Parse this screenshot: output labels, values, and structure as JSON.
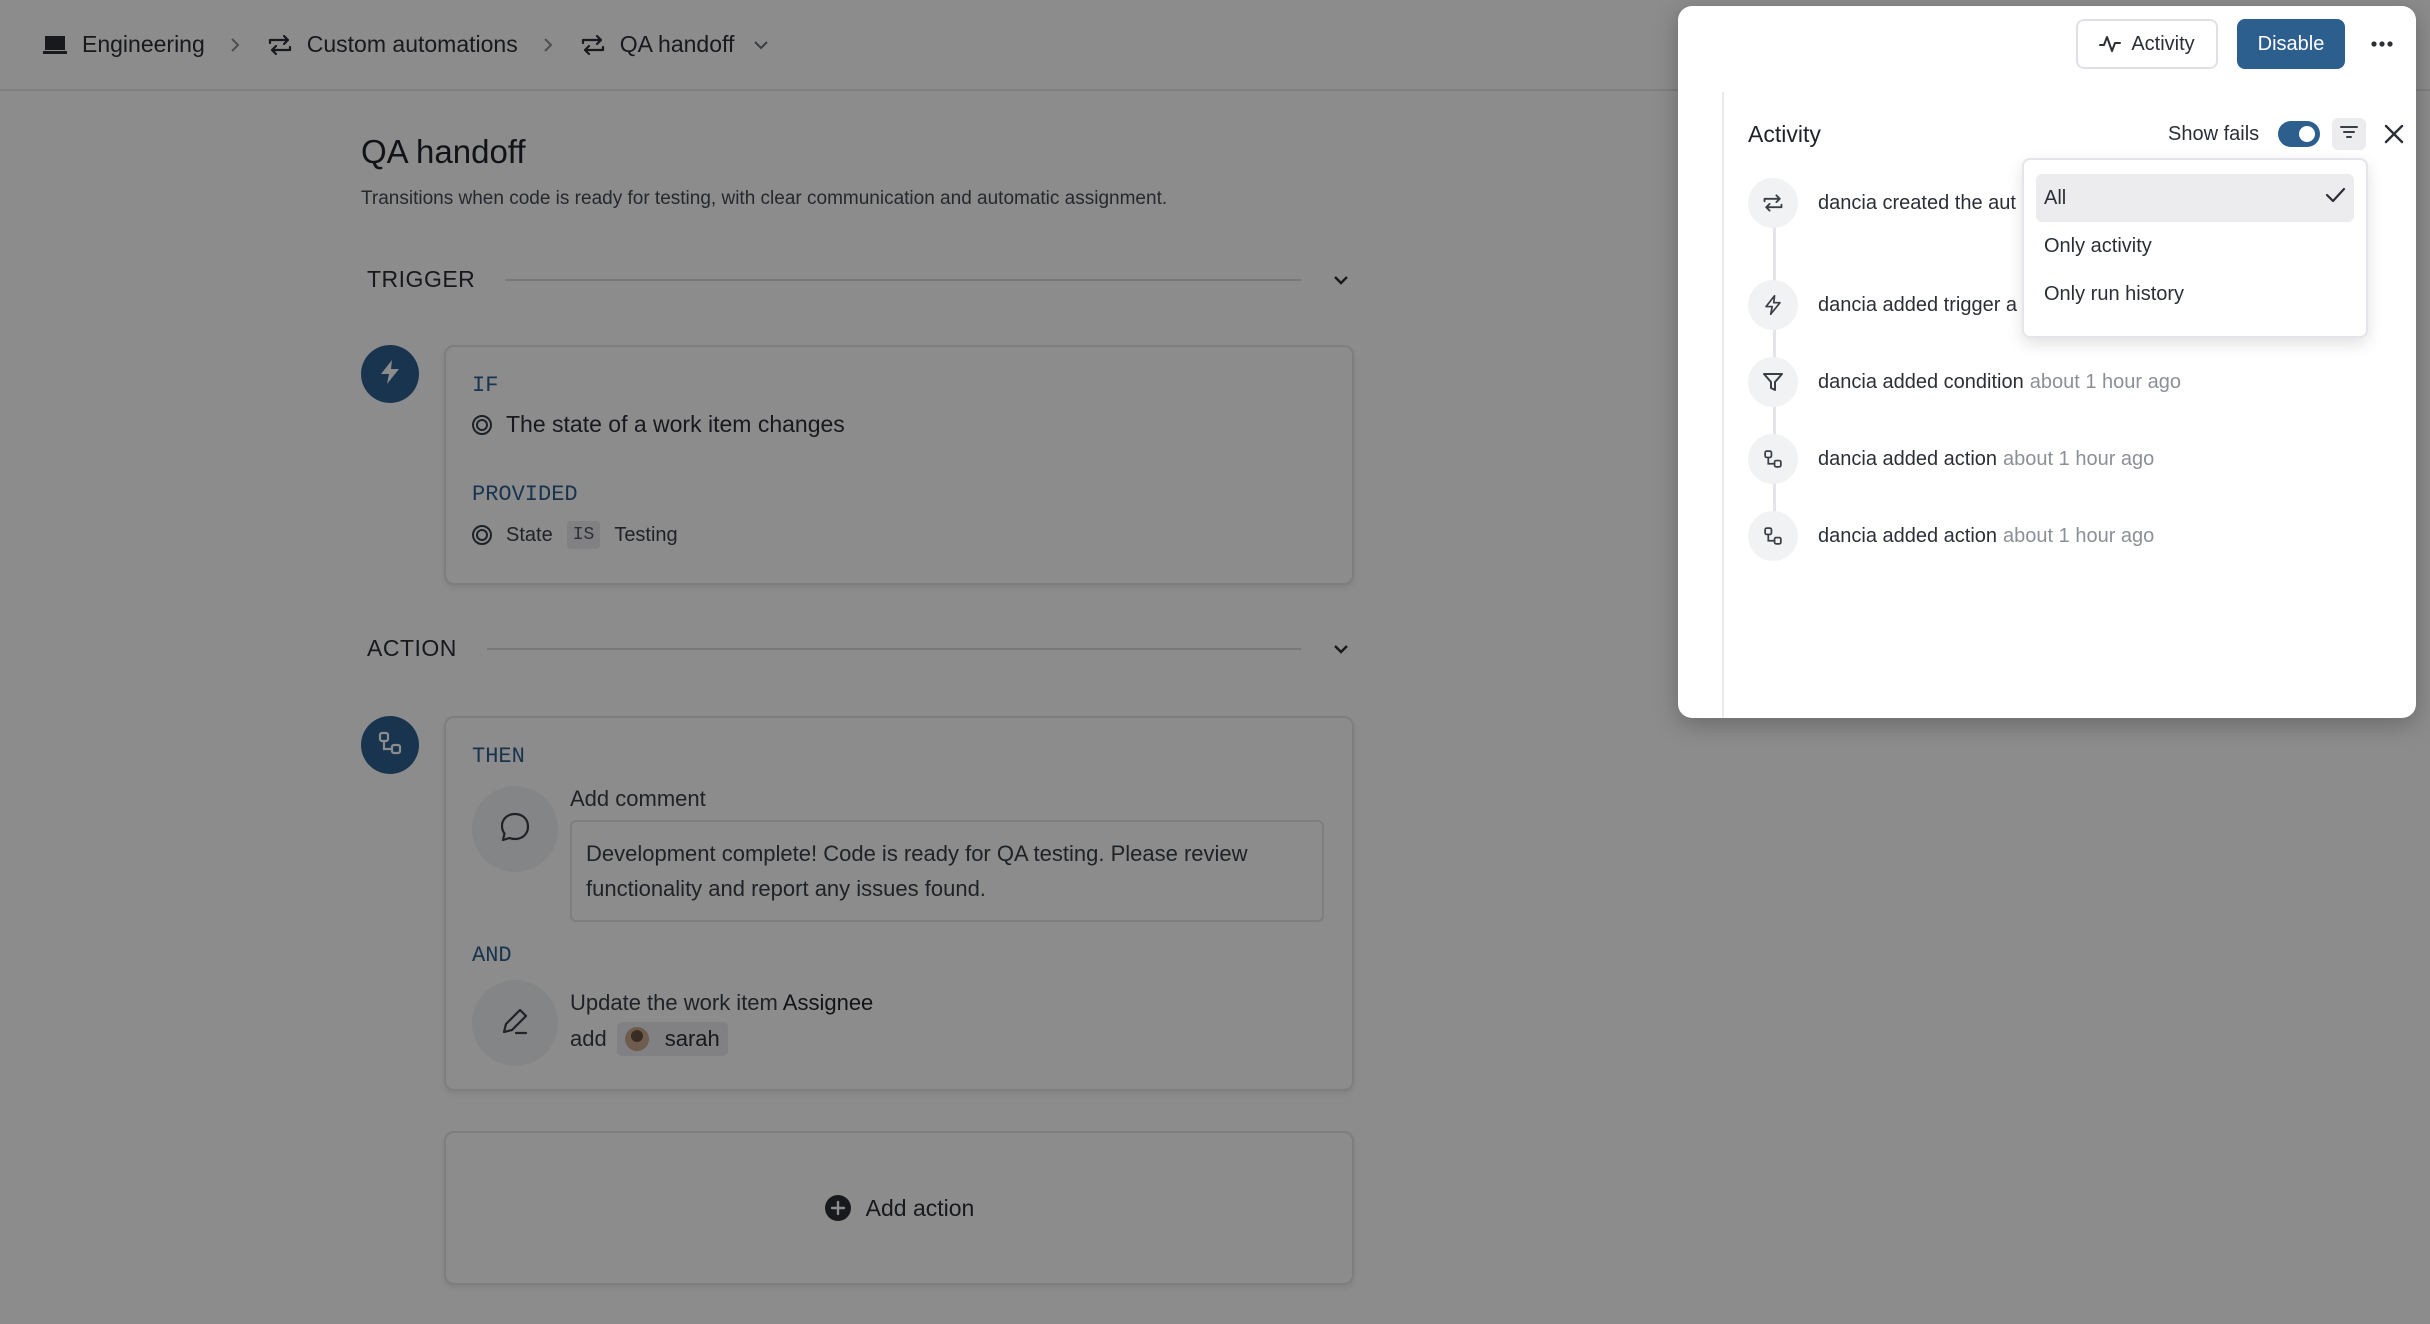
{
  "breadcrumb": {
    "workspace": "Engineering",
    "section": "Custom automations",
    "current": "QA handoff"
  },
  "automation": {
    "title": "QA handoff",
    "description": "Transitions when code is ready for testing, with clear communication and automatic assignment."
  },
  "trigger": {
    "section_label": "TRIGGER",
    "if_keyword": "IF",
    "event": "The state of a work item changes",
    "provided_keyword": "PROVIDED",
    "condition_field": "State",
    "condition_op": "IS",
    "condition_value": "Testing"
  },
  "action": {
    "section_label": "ACTION",
    "then_keyword": "THEN",
    "comment_title": "Add comment",
    "comment_text": "Development complete! Code is ready for QA testing. Please review functionality and report any issues found.",
    "and_keyword": "AND",
    "update_prefix": "Update the work item",
    "update_field": "Assignee",
    "update_verb": "add",
    "assignee": "sarah",
    "add_action_label": "Add action"
  },
  "header_actions": {
    "activity_label": "Activity",
    "disable_label": "Disable"
  },
  "activity_panel": {
    "title": "Activity",
    "show_fails_label": "Show fails",
    "show_fails_on": true,
    "items": [
      {
        "text": "dancia created the aut",
        "time": "",
        "icon": "repeat-icon"
      },
      {
        "text": "dancia added trigger a",
        "time": "",
        "icon": "lightning-icon"
      },
      {
        "text": "dancia added condition",
        "time": "about 1 hour ago",
        "icon": "filter-icon"
      },
      {
        "text": "dancia added action",
        "time": "about 1 hour ago",
        "icon": "workflow-icon"
      },
      {
        "text": "dancia added action",
        "time": "about 1 hour ago",
        "icon": "workflow-icon"
      }
    ]
  },
  "filter_menu": {
    "options": [
      "All",
      "Only activity",
      "Only run history"
    ],
    "selected": "All"
  },
  "colors": {
    "accent": "#2d5f8e",
    "scrim": "rgba(0,0,0,0.45)"
  }
}
